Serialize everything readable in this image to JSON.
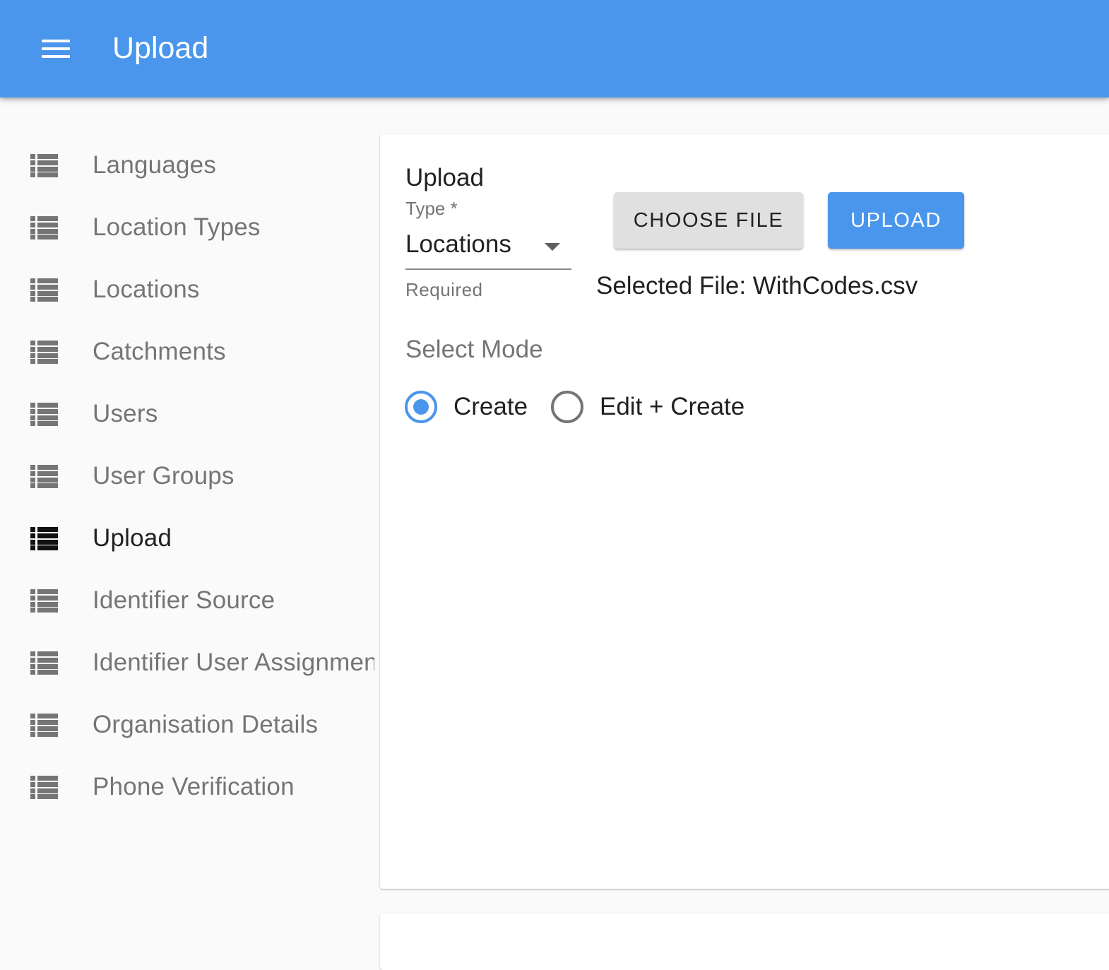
{
  "appbar": {
    "title": "Upload",
    "background_color": "#4a96ec"
  },
  "sidebar": {
    "items": [
      {
        "label": "Languages",
        "icon": "list-icon",
        "active": false
      },
      {
        "label": "Location Types",
        "icon": "list-icon",
        "active": false
      },
      {
        "label": "Locations",
        "icon": "list-icon",
        "active": false
      },
      {
        "label": "Catchments",
        "icon": "list-icon",
        "active": false
      },
      {
        "label": "Users",
        "icon": "list-icon",
        "active": false
      },
      {
        "label": "User Groups",
        "icon": "list-icon",
        "active": false
      },
      {
        "label": "Upload",
        "icon": "list-icon",
        "active": true
      },
      {
        "label": "Identifier Source",
        "icon": "list-icon",
        "active": false
      },
      {
        "label": "Identifier User Assignment",
        "icon": "list-icon",
        "active": false
      },
      {
        "label": "Organisation Details",
        "icon": "list-icon",
        "active": false
      },
      {
        "label": "Phone Verification",
        "icon": "list-icon",
        "active": false
      }
    ]
  },
  "upload_form": {
    "title": "Upload",
    "type_label": "Type *",
    "type_value": "Locations",
    "type_helper": "Required",
    "choose_file_label": "CHOOSE FILE",
    "upload_label": "UPLOAD",
    "selected_file_text": "Selected File: WithCodes.csv",
    "mode_label": "Select Mode",
    "modes": [
      {
        "label": "Create",
        "checked": true
      },
      {
        "label": "Edit + Create",
        "checked": false
      }
    ]
  },
  "colors": {
    "primary": "#4a96ec",
    "text_primary": "#212121",
    "text_secondary": "#757575"
  }
}
